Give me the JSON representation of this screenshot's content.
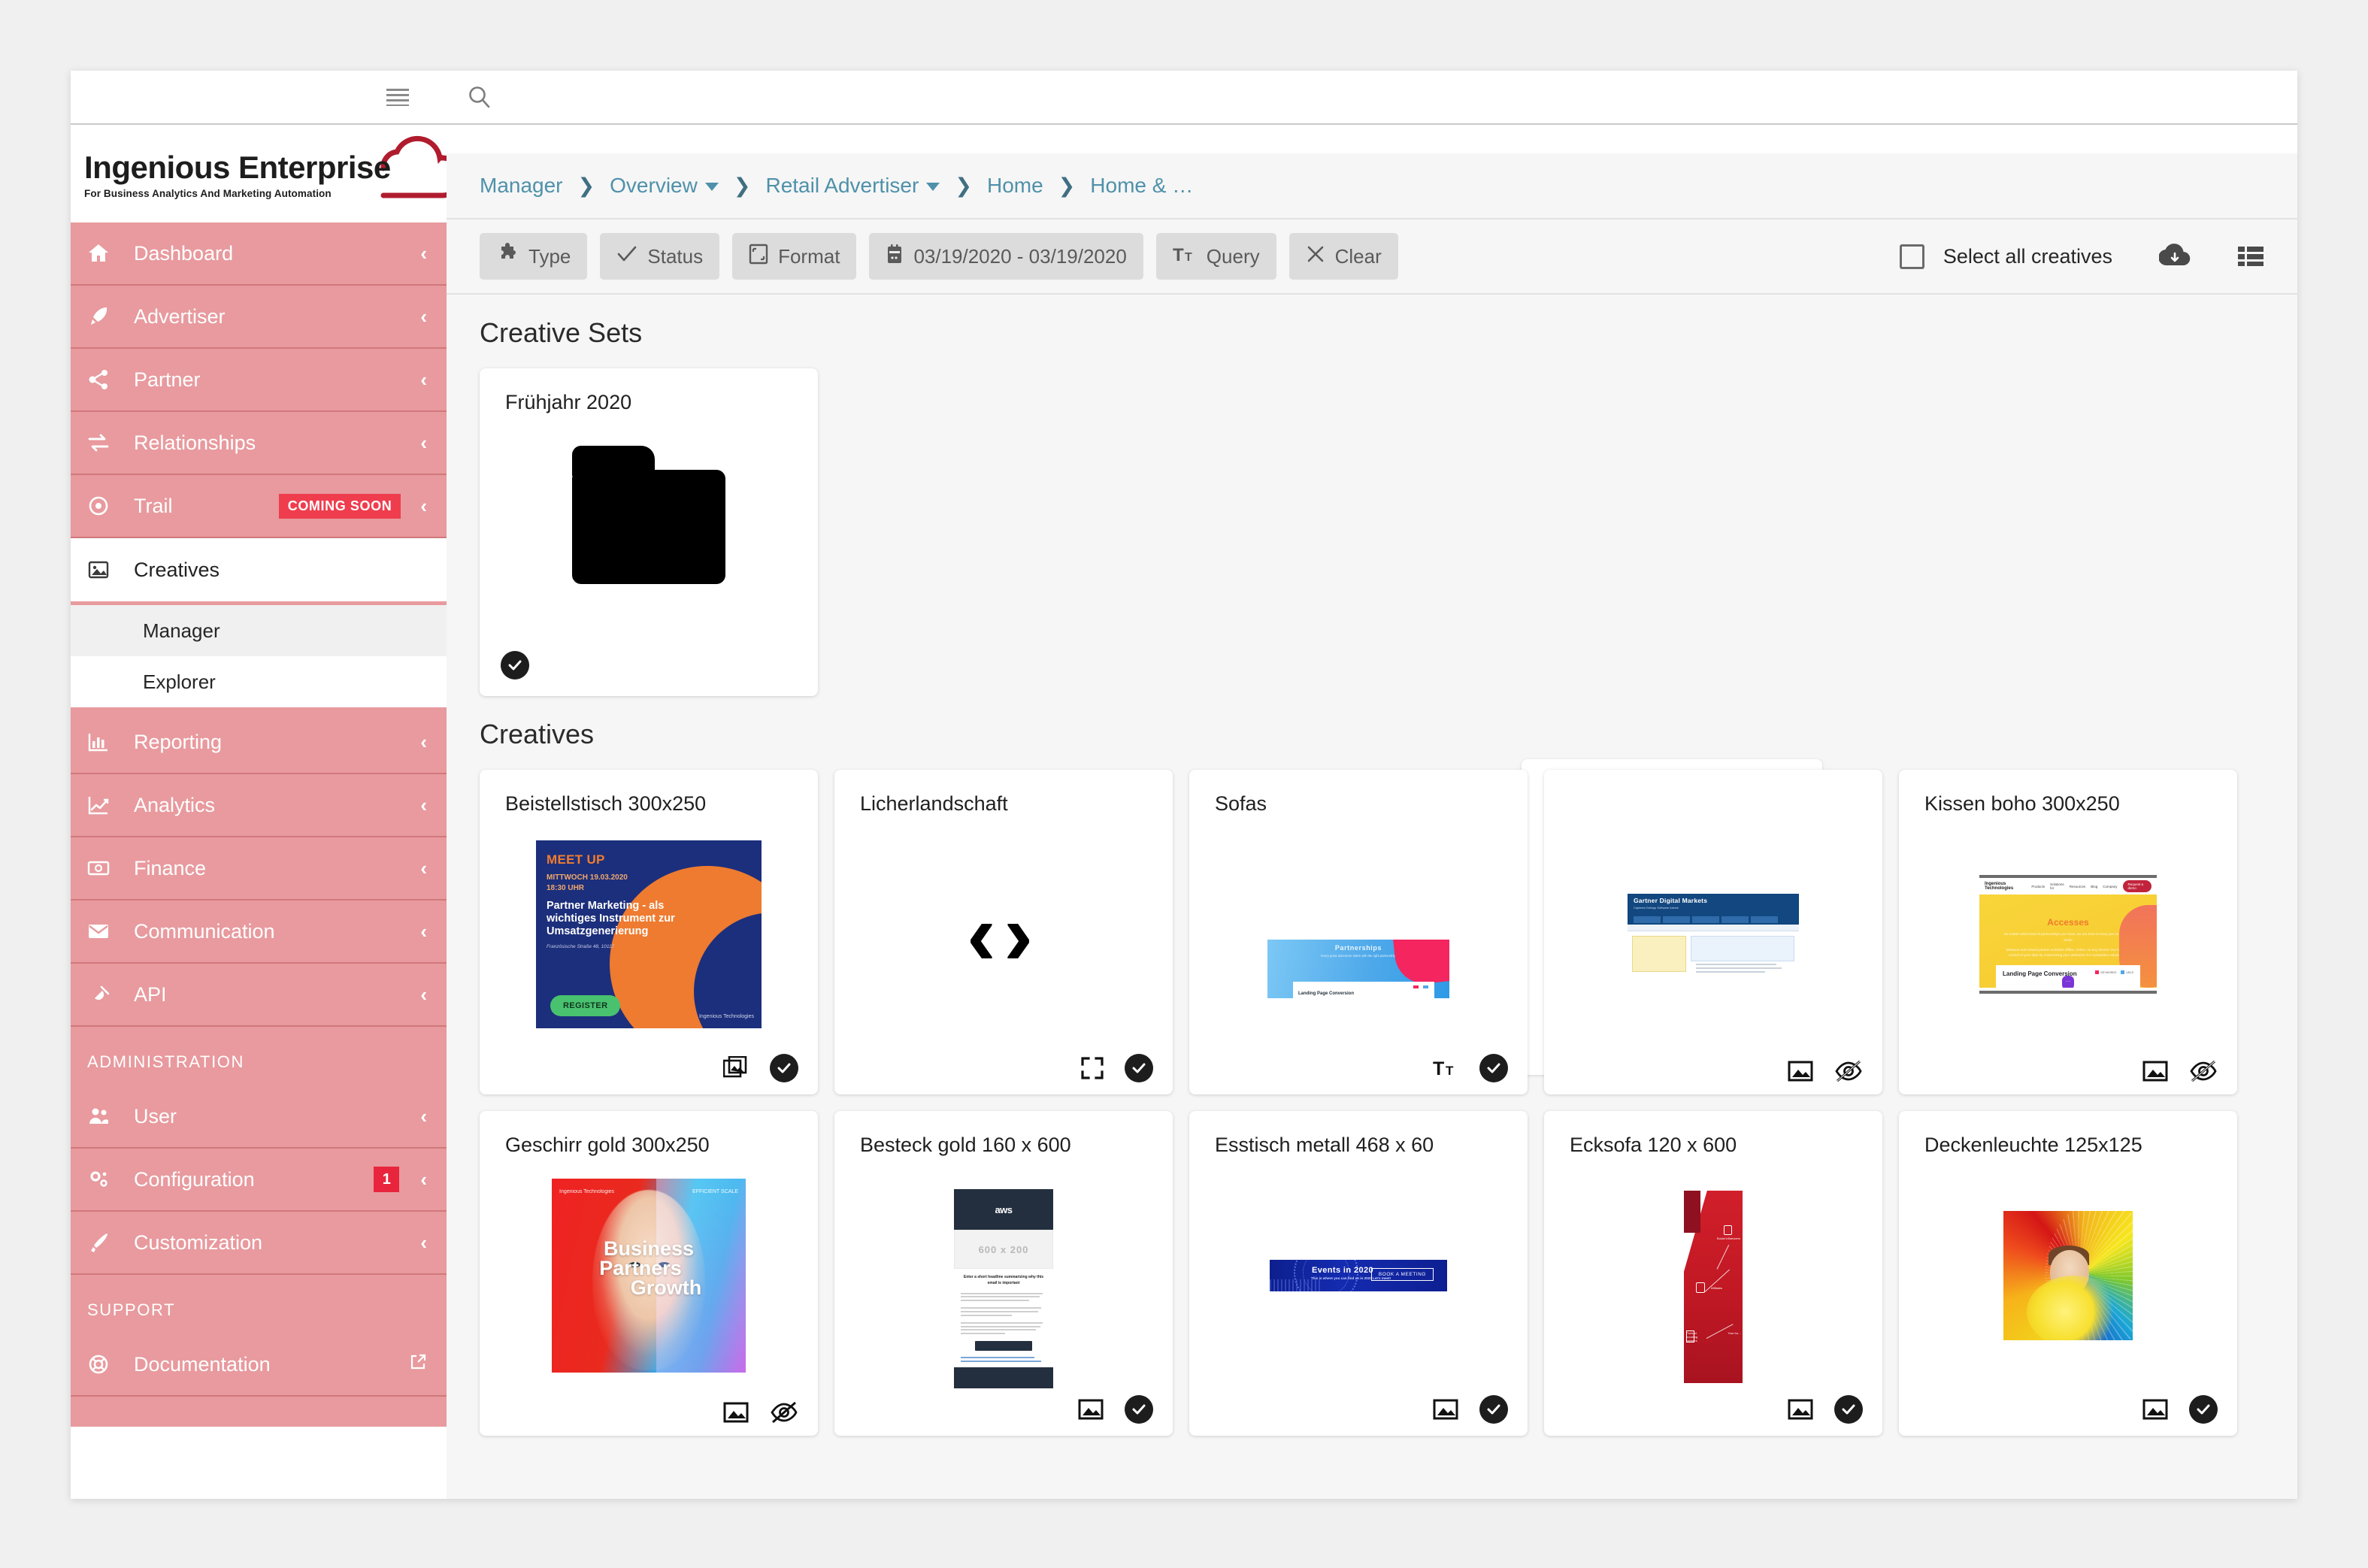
{
  "topbar": {
    "hamburger_icon": "hamburger-menu-icon",
    "search_icon": "search-icon"
  },
  "sidebar": {
    "logo": {
      "title": "Ingenious Enterprise",
      "tagline": "For Business Analytics And Marketing Automation",
      "cloud_icon": "cloud-icon",
      "brand_color": "#b01c2e"
    },
    "accent_color": "#e89a9e",
    "items": [
      {
        "label": "Dashboard",
        "icon": "home-icon",
        "chevron": "‹",
        "badge": null
      },
      {
        "label": "Advertiser",
        "icon": "rocket-icon",
        "chevron": "‹",
        "badge": null
      },
      {
        "label": "Partner",
        "icon": "share-nodes-icon",
        "chevron": "‹",
        "badge": null
      },
      {
        "label": "Relationships",
        "icon": "exchange-arrows-icon",
        "chevron": "‹",
        "badge": null
      },
      {
        "label": "Trail",
        "icon": "target-dot-icon",
        "chevron": "‹",
        "badge": "COMING SOON"
      },
      {
        "label": "Creatives",
        "icon": "image-icon",
        "chevron": "",
        "badge": null
      },
      {
        "label": "Reporting",
        "icon": "bar-chart-icon",
        "chevron": "‹",
        "badge": null
      },
      {
        "label": "Analytics",
        "icon": "line-chart-icon",
        "chevron": "‹",
        "badge": null
      },
      {
        "label": "Finance",
        "icon": "money-bill-icon",
        "chevron": "‹",
        "badge": null
      },
      {
        "label": "Communication",
        "icon": "envelope-icon",
        "chevron": "‹",
        "badge": null
      },
      {
        "label": "API",
        "icon": "plug-icon",
        "chevron": "‹",
        "badge": null
      }
    ],
    "creatives_subitems": [
      {
        "label": "Manager",
        "selected": true
      },
      {
        "label": "Explorer",
        "selected": false
      }
    ],
    "administration_heading": "ADMINISTRATION",
    "administration_items": [
      {
        "label": "User",
        "icon": "users-icon",
        "chevron": "‹",
        "badge": null
      },
      {
        "label": "Configuration",
        "icon": "gears-icon",
        "chevron": "‹",
        "badge": "1"
      },
      {
        "label": "Customization",
        "icon": "paint-brush-icon",
        "chevron": "‹",
        "badge": null
      }
    ],
    "support_heading": "SUPPORT",
    "support_items": [
      {
        "label": "Documentation",
        "icon": "life-ring-icon",
        "chevron": "external-link-icon",
        "badge": null
      }
    ]
  },
  "breadcrumb": [
    {
      "label": "Manager",
      "caret": false
    },
    {
      "label": "Overview",
      "caret": true
    },
    {
      "label": "Retail Advertiser",
      "caret": true
    },
    {
      "label": "Home",
      "caret": false
    },
    {
      "label": "Home & …",
      "caret": false
    }
  ],
  "toolbar": {
    "buttons": [
      {
        "label": "Type",
        "icon": "puzzle-piece-icon"
      },
      {
        "label": "Status",
        "icon": "check-icon"
      },
      {
        "label": "Format",
        "icon": "format-box-icon"
      },
      {
        "label": "03/19/2020 - 03/19/2020",
        "icon": "calendar-icon"
      },
      {
        "label": "Query",
        "icon": "text-size-icon"
      },
      {
        "label": "Clear",
        "icon": "close-x-icon"
      }
    ],
    "select_all_label": "Select all creatives",
    "select_all_checked": false,
    "download_icon": "cloud-download-icon",
    "list_view_icon": "list-view-icon"
  },
  "sections": {
    "creative_sets_title": "Creative Sets",
    "creatives_title": "Creatives"
  },
  "creative_sets": [
    {
      "name": "Frühjahr 2020",
      "icon": "folder-icon",
      "selected": true
    }
  ],
  "creatives_row1": [
    {
      "name": "Beistellstisch 300x250",
      "thumb": "meetup-banner",
      "icons": [
        "images-stack-icon",
        "check-circle-icon"
      ],
      "banner": {
        "kicker": "MEET UP",
        "date": "MITTWOCH 19.03.2020",
        "time": "18:30 UHR",
        "headline": "Partner Marketing - als wichtiges Instrument zur Umsatzgenerierung",
        "address": "Französische Straße 48, 10117",
        "cta": "REGISTER",
        "brand": "Ingenious Technologies",
        "bg_color": "#1c2f7c",
        "accent_color": "#ee7b30",
        "cta_color": "#49c26f"
      }
    },
    {
      "name": "Licherlandschaft",
      "thumb": "code-glyph",
      "glyph": "‹›",
      "icons": [
        "fullscreen-icon",
        "check-circle-icon"
      ]
    },
    {
      "name": "Sofas",
      "thumb": "partnerships-landing",
      "icons": [
        "text-size-icon",
        "check-circle-icon"
      ],
      "landing": {
        "title": "Partnerships",
        "subtitle": "Every great adventure starts with the right partnership",
        "card_title": "Landing Page Conversion"
      }
    },
    {
      "name": "",
      "thumb": "gartner-screenshot",
      "icons": [
        "image-icon",
        "eye-slash-icon"
      ],
      "screenshot": {
        "brand": "Gartner Digital Markets",
        "brands_line": "Capterra  GetApp  Software Advice",
        "panel_title": "Source Tracking",
        "form_title": "Create Your Source Tracking Key"
      }
    },
    {
      "name": "Kissen boho 300x250",
      "thumb": "accesses-landing",
      "icons": [
        "image-icon",
        "eye-slash-icon"
      ],
      "landing": {
        "brand": "Ingenious Technologies",
        "nav": [
          "Products",
          "Solutions for",
          "Resources",
          "Blog",
          "Company"
        ],
        "cta": "Request a demo",
        "title": "Accesses",
        "subtitle": "No matter which kind of partnerships you have, we are here to keep you on the right track!",
        "body": "Measure and reward partner activities offline, online, on any device! You have full control of your data by customizing your attribution for competitive advantage.",
        "card_title": "Landing Page Conversion",
        "legend": [
          "KEYWORDS",
          "URLS"
        ]
      }
    }
  ],
  "creatives_row2": [
    {
      "name": "Geschirr gold 300x250",
      "thumb": "business-partners-growth",
      "icons": [
        "image-icon",
        "eye-slash-icon"
      ],
      "banner": {
        "line1": "Business",
        "line2": "Partners",
        "line3": "Growth",
        "brand": "Ingenious Technologies",
        "tag": "EFFICIENT SCALE"
      }
    },
    {
      "name": "Besteck gold 160 x 600",
      "thumb": "aws-email-template",
      "icons": [
        "image-icon",
        "check-circle-icon"
      ],
      "email": {
        "brand": "aws",
        "placeholder": "600 x 200",
        "headline": "Enter a short headline summarizing why this email is important"
      }
    },
    {
      "name": "Esstisch metall 468 x 60",
      "thumb": "events-banner",
      "icons": [
        "image-icon",
        "check-circle-icon"
      ],
      "banner": {
        "title": "Events in 2020",
        "subtitle": "This is where you can find us in 2020  Let's meet!",
        "cta": "BOOK A MEETING"
      }
    },
    {
      "name": "Ecksofa 120 x 600",
      "thumb": "red-skyscraper",
      "icons": [
        "image-icon",
        "check-circle-icon"
      ],
      "banner": {
        "labels": [
          "Social influencers",
          "Affiliates",
          "Product bundling partners",
          "Your bu…"
        ]
      }
    },
    {
      "name": "Deckenleuchte 125x125",
      "thumb": "rainbow-portrait",
      "icons": [
        "image-icon",
        "check-circle-icon"
      ]
    }
  ]
}
